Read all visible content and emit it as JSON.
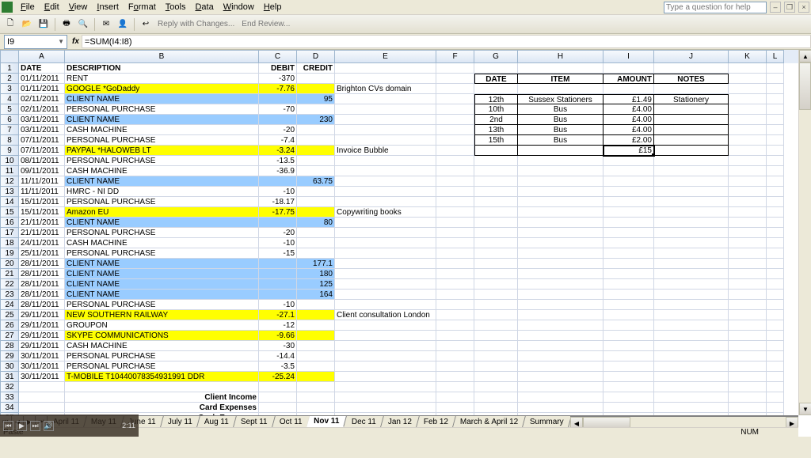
{
  "menu": {
    "file": "File",
    "edit": "Edit",
    "view": "View",
    "insert": "Insert",
    "format": "Format",
    "tools": "Tools",
    "data": "Data",
    "window": "Window",
    "help": "Help"
  },
  "help_search_placeholder": "Type a question for help",
  "toolbar": {
    "reply_changes": "Reply with Changes...",
    "end_review": "End Review..."
  },
  "namebox": "I9",
  "formula": "=SUM(I4:I8)",
  "columns": [
    "A",
    "B",
    "C",
    "D",
    "E",
    "F",
    "G",
    "H",
    "I",
    "J",
    "K",
    "L"
  ],
  "headers": {
    "A": "DATE",
    "B": "DESCRIPTION",
    "C": "DEBIT",
    "D": "CREDIT"
  },
  "side_headers": {
    "G": "DATE",
    "H": "ITEM",
    "I": "AMOUNT",
    "J": "NOTES"
  },
  "rows": [
    {
      "r": 2,
      "A": "01/11/2011",
      "B": "RENT",
      "C": "-370",
      "hl": ""
    },
    {
      "r": 3,
      "A": "01/11/2011",
      "B": "GOOGLE *GoDaddy",
      "C": "-7.76",
      "E": "Brighton CVs domain",
      "hl": "yellow"
    },
    {
      "r": 4,
      "A": "02/11/2011",
      "B": "CLIENT NAME",
      "D": "95",
      "hl": "blue"
    },
    {
      "r": 5,
      "A": "02/11/2011",
      "B": "PERSONAL PURCHASE",
      "C": "-70"
    },
    {
      "r": 6,
      "A": "03/11/2011",
      "B": "CLIENT NAME",
      "D": "230",
      "hl": "blue"
    },
    {
      "r": 7,
      "A": "03/11/2011",
      "B": "CASH MACHINE",
      "C": "-20"
    },
    {
      "r": 8,
      "A": "07/11/2011",
      "B": "PERSONAL PURCHASE",
      "C": "-7.4"
    },
    {
      "r": 9,
      "A": "07/11/2011",
      "B": "PAYPAL *HALOWEB LT",
      "C": "-3.24",
      "E": "Invoice Bubble",
      "hl": "yellow"
    },
    {
      "r": 10,
      "A": "08/11/2011",
      "B": "PERSONAL PURCHASE",
      "C": "-13.5"
    },
    {
      "r": 11,
      "A": "09/11/2011",
      "B": "CASH MACHINE",
      "C": "-36.9"
    },
    {
      "r": 12,
      "A": "11/11/2011",
      "B": "CLIENT NAME",
      "D": "63.75",
      "hl": "blue"
    },
    {
      "r": 13,
      "A": "11/11/2011",
      "B": "HMRC - NI DD",
      "C": "-10"
    },
    {
      "r": 14,
      "A": "15/11/2011",
      "B": "PERSONAL PURCHASE",
      "C": "-18.17"
    },
    {
      "r": 15,
      "A": "15/11/2011",
      "B": "Amazon EU",
      "C": "-17.75",
      "E": "Copywriting books",
      "hl": "yellow"
    },
    {
      "r": 16,
      "A": "21/11/2011",
      "B": "CLIENT NAME",
      "D": "80",
      "hl": "blue"
    },
    {
      "r": 17,
      "A": "21/11/2011",
      "B": "PERSONAL PURCHASE",
      "C": "-20"
    },
    {
      "r": 18,
      "A": "24/11/2011",
      "B": "CASH MACHINE",
      "C": "-10"
    },
    {
      "r": 19,
      "A": "25/11/2011",
      "B": "PERSONAL PURCHASE",
      "C": "-15"
    },
    {
      "r": 20,
      "A": "28/11/2011",
      "B": "CLIENT NAME",
      "D": "177.1",
      "hl": "blue"
    },
    {
      "r": 21,
      "A": "28/11/2011",
      "B": "CLIENT NAME",
      "D": "180",
      "hl": "blue"
    },
    {
      "r": 22,
      "A": "28/11/2011",
      "B": "CLIENT NAME",
      "D": "125",
      "hl": "blue"
    },
    {
      "r": 23,
      "A": "28/11/2011",
      "B": "CLIENT NAME",
      "D": "164",
      "hl": "blue"
    },
    {
      "r": 24,
      "A": "28/11/2011",
      "B": "PERSONAL PURCHASE",
      "C": "-10"
    },
    {
      "r": 25,
      "A": "29/11/2011",
      "B": "NEW SOUTHERN RAILWAY",
      "C": "-27.1",
      "E": "Client consultation London",
      "hl": "yellow"
    },
    {
      "r": 26,
      "A": "29/11/2011",
      "B": "GROUPON",
      "C": "-12"
    },
    {
      "r": 27,
      "A": "29/11/2011",
      "B": "SKYPE COMMUNICATIONS",
      "C": "-9.66",
      "hl": "yellow"
    },
    {
      "r": 28,
      "A": "29/11/2011",
      "B": "CASH MACHINE",
      "C": "-30"
    },
    {
      "r": 29,
      "A": "30/11/2011",
      "B": "PERSONAL PURCHASE",
      "C": "-14.4"
    },
    {
      "r": 30,
      "A": "30/11/2011",
      "B": "PERSONAL PURCHASE",
      "C": "-3.5"
    },
    {
      "r": 31,
      "A": "30/11/2011",
      "B": "T-MOBILE          T10440078354931991 DDR",
      "C": "-25.24",
      "hl": "yellow"
    }
  ],
  "side_rows": [
    {
      "G": "12th",
      "H": "Sussex Stationers",
      "I": "£1.49",
      "J": "Stationery"
    },
    {
      "G": "10th",
      "H": "Bus",
      "I": "£4.00",
      "J": ""
    },
    {
      "G": "2nd",
      "H": "Bus",
      "I": "£4.00",
      "J": ""
    },
    {
      "G": "13th",
      "H": "Bus",
      "I": "£4.00",
      "J": ""
    },
    {
      "G": "15th",
      "H": "Bus",
      "I": "£2.00",
      "J": ""
    }
  ],
  "side_total": "£15",
  "summary": {
    "client_income": "Client Income",
    "card_expenses": "Card Expenses",
    "cash_expenses": "Cash Expenses"
  },
  "tabs": [
    "April 11",
    "May 11",
    "June 11",
    "July 11",
    "Aug 11",
    "Sept 11",
    "Oct 11",
    "Nov 11",
    "Dec 11",
    "Jan 12",
    "Feb 12",
    "March & April 12",
    "Summary"
  ],
  "active_tab": "Nov 11",
  "status": {
    "left": "Paste",
    "num": "NUM"
  },
  "player_time": "2:11"
}
